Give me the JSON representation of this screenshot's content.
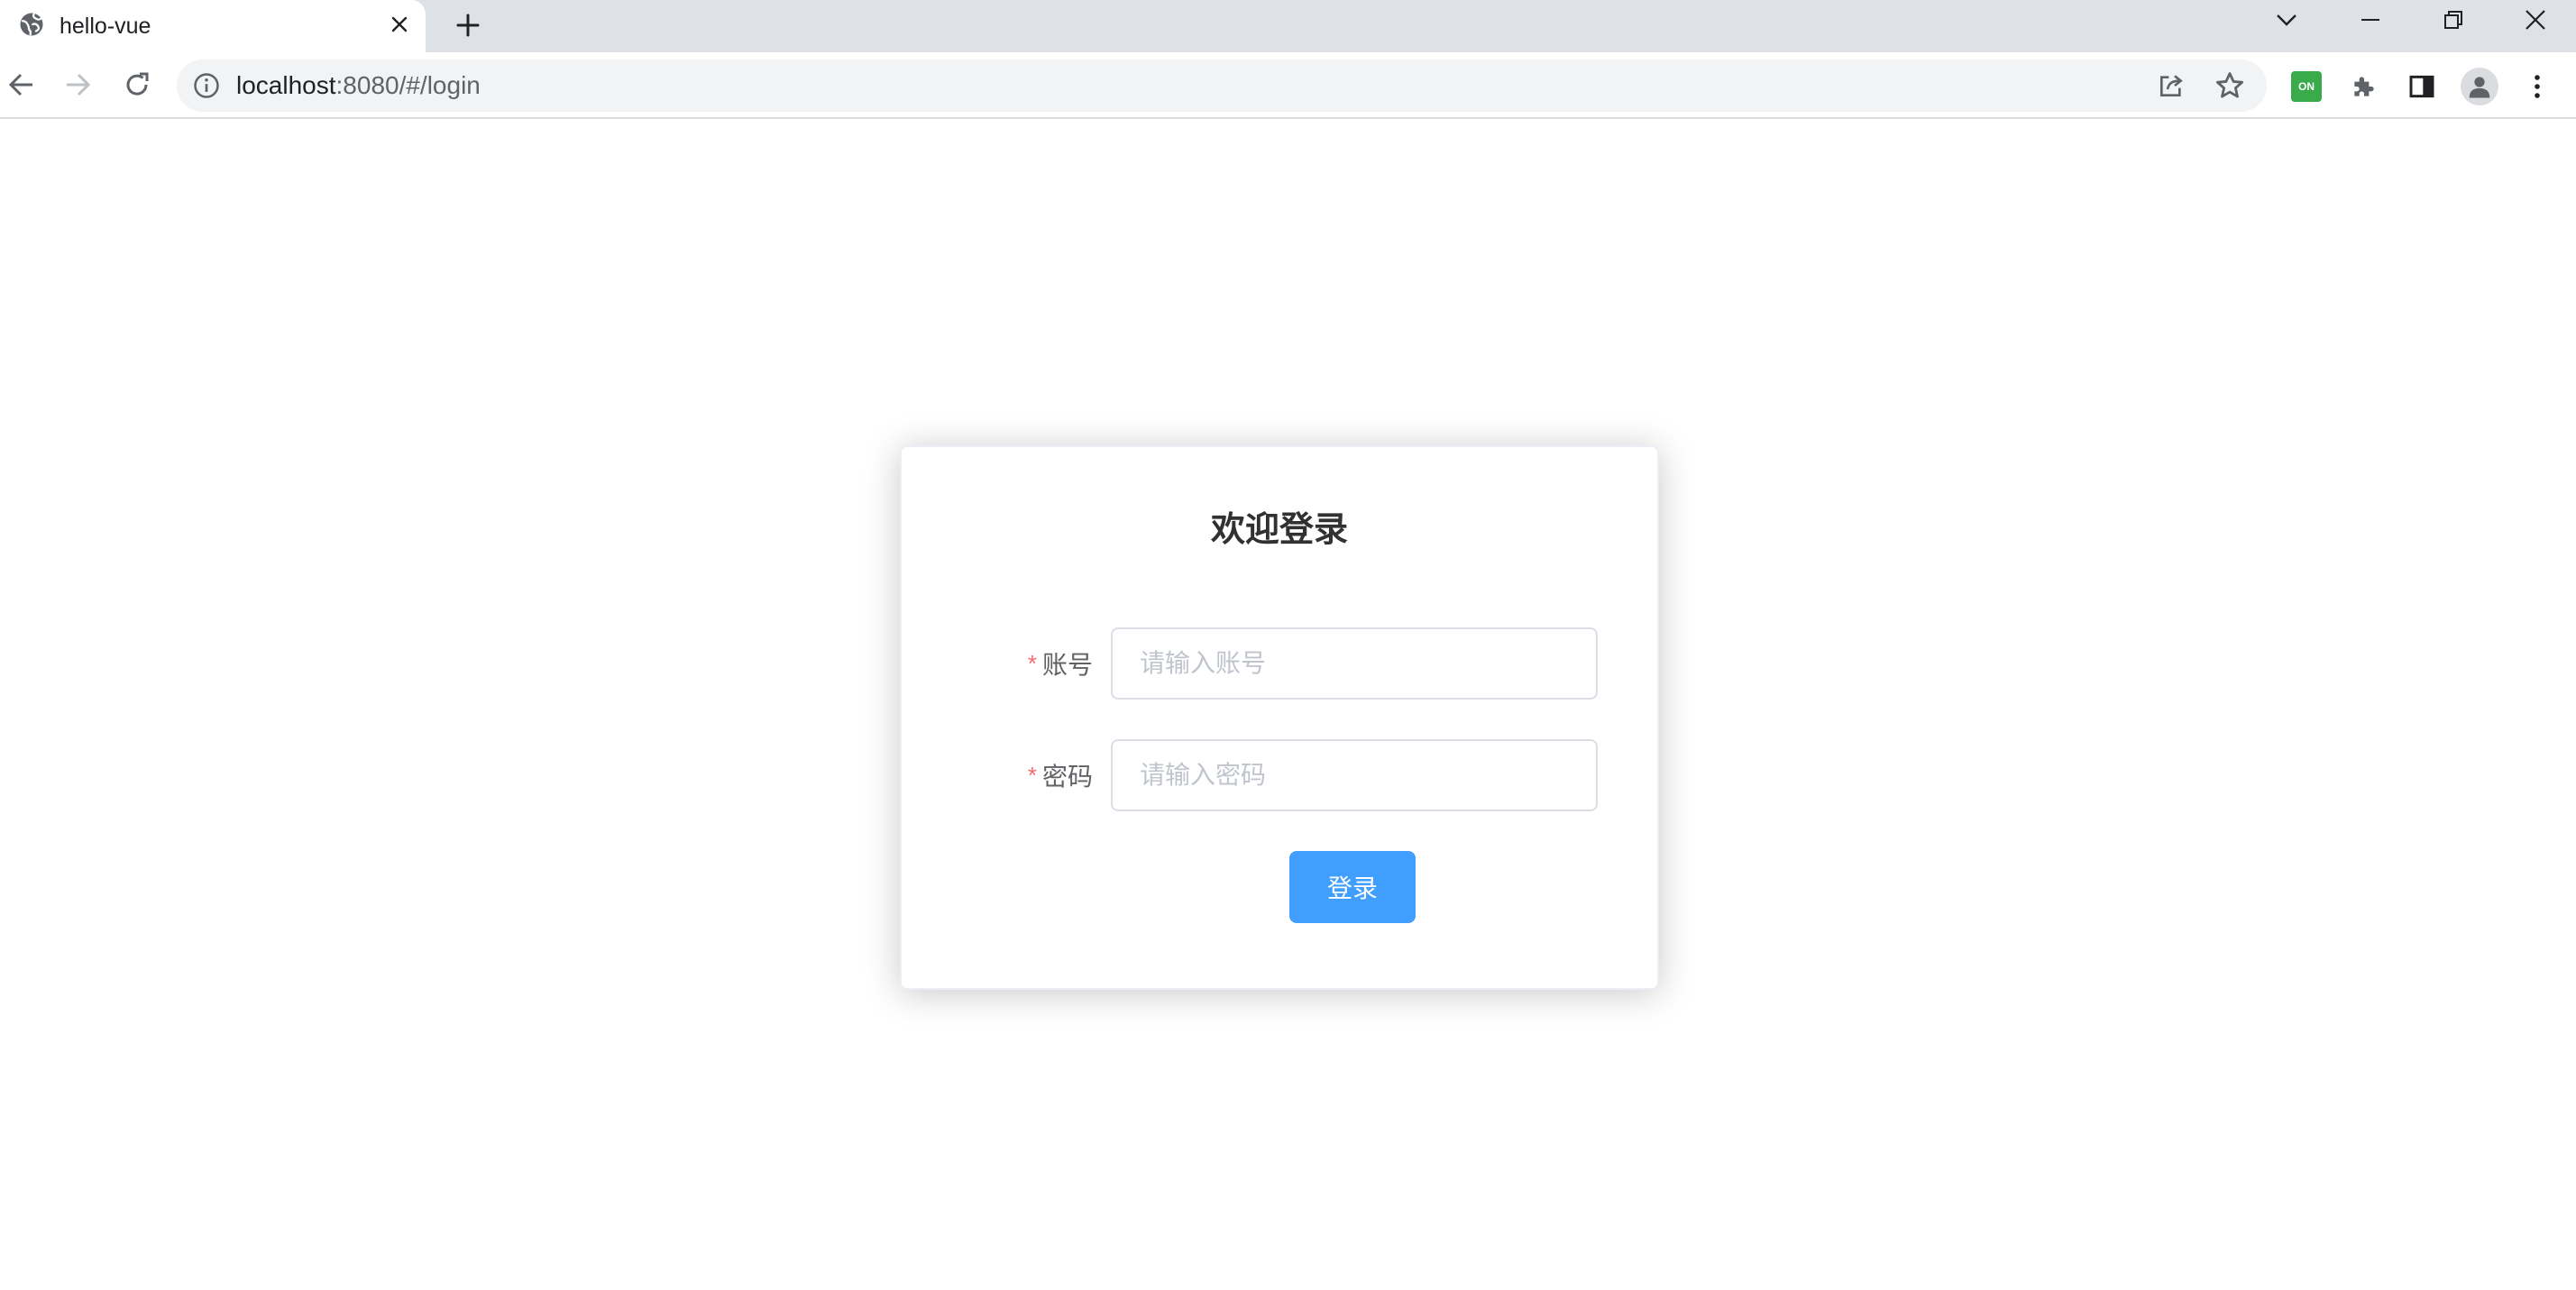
{
  "browser": {
    "tab": {
      "title": "hello-vue",
      "favicon": "globe-icon"
    },
    "address": {
      "host": "localhost",
      "path": ":8080/#/login"
    },
    "extension_badge": "ON",
    "colors": {
      "tabstrip": "#dee1e6",
      "omnibox": "#f1f3f4",
      "extension": "#3aab4b"
    }
  },
  "login": {
    "title": "欢迎登录",
    "required_mark": "*",
    "account_label": "账号",
    "account_placeholder": "请输入账号",
    "account_value": "",
    "password_label": "密码",
    "password_placeholder": "请输入密码",
    "password_value": "",
    "submit_label": "登录",
    "colors": {
      "primary": "#409eff",
      "required": "#f56c6c",
      "border": "#dcdfe6"
    }
  }
}
